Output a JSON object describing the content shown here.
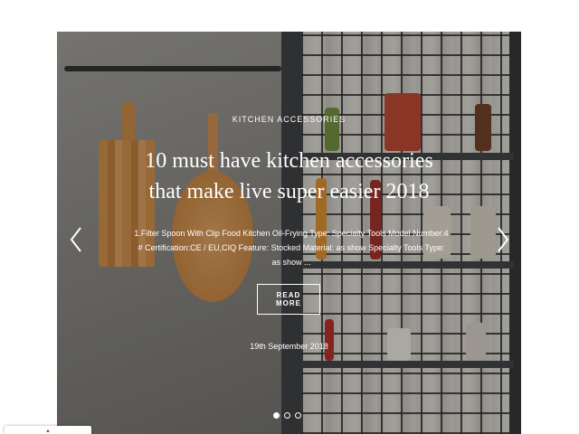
{
  "slide": {
    "category": "KITCHEN ACCESSORIES",
    "title": "10 must have kitchen accessories that make live super easier 2018",
    "description": "1.Filter Spoon With Clip Food Kitchen Oil-Frying Type: Specialty Tools Model Number:4 # Certification:CE / EU,CIQ Feature: Stocked Material: as show Specialty Tools Type: as show ...",
    "read_more_label": "READ MORE",
    "date": "19th September 2018"
  },
  "carousel": {
    "slide_count": 3,
    "active_index": 0,
    "prev_icon": "chevron-left-icon",
    "next_icon": "chevron-right-icon"
  },
  "colors": {
    "text": "#ffffff",
    "page_background": "#ffffff"
  }
}
